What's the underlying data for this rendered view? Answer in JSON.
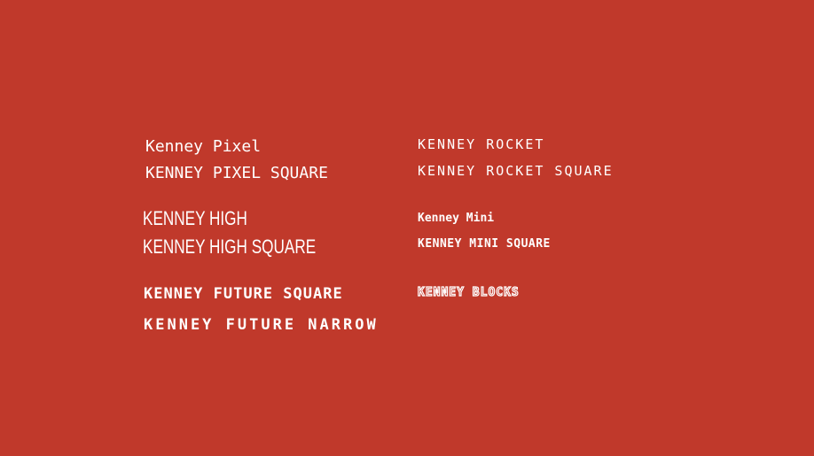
{
  "canvas": {
    "background": "#c0392b",
    "text_color": "#ffffff"
  },
  "fonts": {
    "left": [
      {
        "id": "kp",
        "label": "Kenney Pixel"
      },
      {
        "id": "kps",
        "label": "KENNEY PIXEL SQUARE"
      },
      {
        "id": "kh",
        "label": "KENNEY HIGH"
      },
      {
        "id": "khs",
        "label": "KENNEY HIGH SQUARE"
      },
      {
        "id": "kfs",
        "label": "KENNEY FUTURE SQUARE"
      },
      {
        "id": "kfn",
        "label": "KENNEY FUTURE NARROW"
      }
    ],
    "right": [
      {
        "id": "kr",
        "label": "KENNEY ROCKET"
      },
      {
        "id": "krs",
        "label": "KENNEY ROCKET SQUARE"
      },
      {
        "id": "km",
        "label": "Kenney Mini"
      },
      {
        "id": "kms",
        "label": "KENNEY MINI SQUARE"
      },
      {
        "id": "kb",
        "label": "KENNEY BLOCKS"
      }
    ]
  }
}
